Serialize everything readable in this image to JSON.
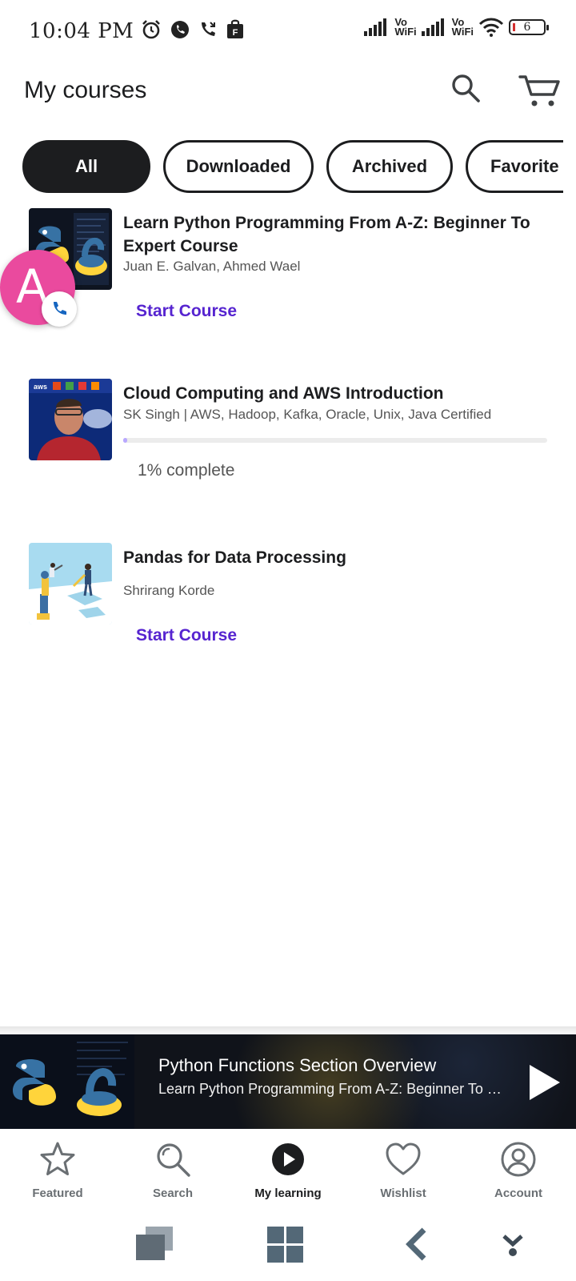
{
  "status_bar": {
    "time": "10:04 PM",
    "vowifi_1": "Vo\nWiFi",
    "vowifi_2": "Vo\nWiFi",
    "battery": "6"
  },
  "header": {
    "title": "My courses",
    "search_icon": "search-icon",
    "cart_icon": "cart-icon"
  },
  "filters": [
    {
      "label": "All",
      "active": true
    },
    {
      "label": "Downloaded",
      "active": false
    },
    {
      "label": "Archived",
      "active": false
    },
    {
      "label": "Favorite",
      "active": false
    }
  ],
  "courses": [
    {
      "title": "Learn Python Programming From A-Z: Beginner To Expert Course",
      "authors": "Juan E. Galvan, Ahmed Wael",
      "action": "Start Course"
    },
    {
      "title": "Cloud Computing and AWS Introduction",
      "authors": "SK Singh | AWS, Hadoop, Kafka, Oracle, Unix, Java Certified",
      "progress_percent": 1,
      "progress_text": "1% complete"
    },
    {
      "title": "Pandas for Data Processing",
      "authors": "Shrirang Korde",
      "action": "Start Course"
    }
  ],
  "chat_head": {
    "letter": "A"
  },
  "mini_player": {
    "title": "Python Functions Section Overview",
    "subtitle": "Learn Python Programming From A-Z: Beginner To Expert Course"
  },
  "bottom_nav": [
    {
      "label": "Featured",
      "icon": "star-icon",
      "active": false
    },
    {
      "label": "Search",
      "icon": "search-icon",
      "active": false
    },
    {
      "label": "My learning",
      "icon": "play-circle-icon",
      "active": true
    },
    {
      "label": "Wishlist",
      "icon": "heart-icon",
      "active": false
    },
    {
      "label": "Account",
      "icon": "account-icon",
      "active": false
    }
  ],
  "colors": {
    "accent": "#5624d0",
    "text": "#1c1d1f",
    "muted": "#6a6f73",
    "chat_head": "#ea4a9e"
  }
}
